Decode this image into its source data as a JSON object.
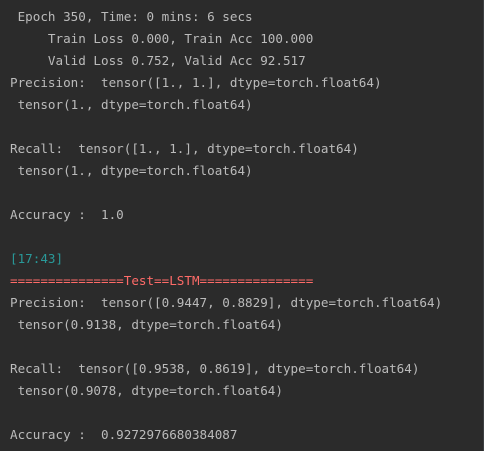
{
  "console": {
    "lines": [
      {
        "text": " Epoch 350, Time: 0 mins: 6 secs",
        "kind": "normal"
      },
      {
        "text": "     Train Loss 0.000, Train Acc 100.000",
        "kind": "normal"
      },
      {
        "text": "     Valid Loss 0.752, Valid Acc 92.517",
        "kind": "normal"
      },
      {
        "text": "Precision:  tensor([1., 1.], dtype=torch.float64)",
        "kind": "normal"
      },
      {
        "text": " tensor(1., dtype=torch.float64)",
        "kind": "normal"
      },
      {
        "text": "",
        "kind": "blank"
      },
      {
        "text": "Recall:  tensor([1., 1.], dtype=torch.float64)",
        "kind": "normal"
      },
      {
        "text": " tensor(1., dtype=torch.float64)",
        "kind": "normal"
      },
      {
        "text": "",
        "kind": "blank"
      },
      {
        "text": "Accuracy :  1.0",
        "kind": "normal"
      },
      {
        "text": "",
        "kind": "blank"
      },
      {
        "text": "[17:43]",
        "kind": "timestamp"
      },
      {
        "text": "===============Test==LSTM===============",
        "kind": "header"
      },
      {
        "text": "Precision:  tensor([0.9447, 0.8829], dtype=torch.float64)",
        "kind": "normal"
      },
      {
        "text": " tensor(0.9138, dtype=torch.float64)",
        "kind": "normal"
      },
      {
        "text": "",
        "kind": "blank"
      },
      {
        "text": "Recall:  tensor([0.9538, 0.8619], dtype=torch.float64)",
        "kind": "normal"
      },
      {
        "text": " tensor(0.9078, dtype=torch.float64)",
        "kind": "normal"
      },
      {
        "text": "",
        "kind": "blank"
      },
      {
        "text": "Accuracy :  0.9272976680384087",
        "kind": "normal"
      }
    ]
  },
  "colors": {
    "background": "#2b2b2b",
    "text": "#bbbbbb",
    "timestamp": "#299999",
    "header": "#ff6b68"
  }
}
